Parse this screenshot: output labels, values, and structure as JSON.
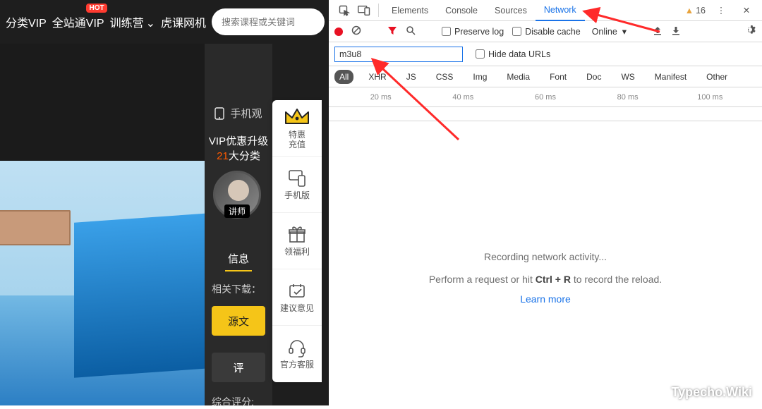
{
  "site": {
    "nav": {
      "items": [
        "分类VIP",
        "全站通VIP",
        "训练营",
        "虎课网机"
      ],
      "hot_badge": "HOT",
      "search_placeholder": "搜索课程或关键词"
    },
    "promo": {
      "line1": "手机观",
      "line2_prefix": "VIP优惠升级 ",
      "line2_num": "21",
      "line2_suffix": "大分类"
    },
    "teacher_tag": "讲师",
    "tabs": {
      "info": "信息"
    },
    "related_label": "相关下载：",
    "btn_source": "源文",
    "btn_review": "评",
    "rating_label": "综合评分:"
  },
  "sidebar": {
    "items": [
      {
        "label": "特惠\n充值"
      },
      {
        "label": "手机版"
      },
      {
        "label": "领福利"
      },
      {
        "label": "建议意见"
      },
      {
        "label": "官方客服"
      }
    ]
  },
  "devtools": {
    "tabs": {
      "elements": "Elements",
      "console": "Console",
      "sources": "Sources",
      "network": "Network"
    },
    "warning_count": "16",
    "row2": {
      "preserve_log": "Preserve log",
      "disable_cache": "Disable cache",
      "online": "Online"
    },
    "filter_value": "m3u8",
    "hide_data_urls": "Hide data URLs",
    "types": [
      "All",
      "XHR",
      "JS",
      "CSS",
      "Img",
      "Media",
      "Font",
      "Doc",
      "WS",
      "Manifest",
      "Other"
    ],
    "timeline_ticks": [
      "20 ms",
      "40 ms",
      "60 ms",
      "80 ms",
      "100 ms"
    ],
    "empty": {
      "title": "Recording network activity...",
      "hint_prefix": "Perform a request or hit ",
      "hint_key": "Ctrl + R",
      "hint_suffix": " to record the reload.",
      "learn_more": "Learn more"
    }
  },
  "watermark": "Typecho.Wiki"
}
